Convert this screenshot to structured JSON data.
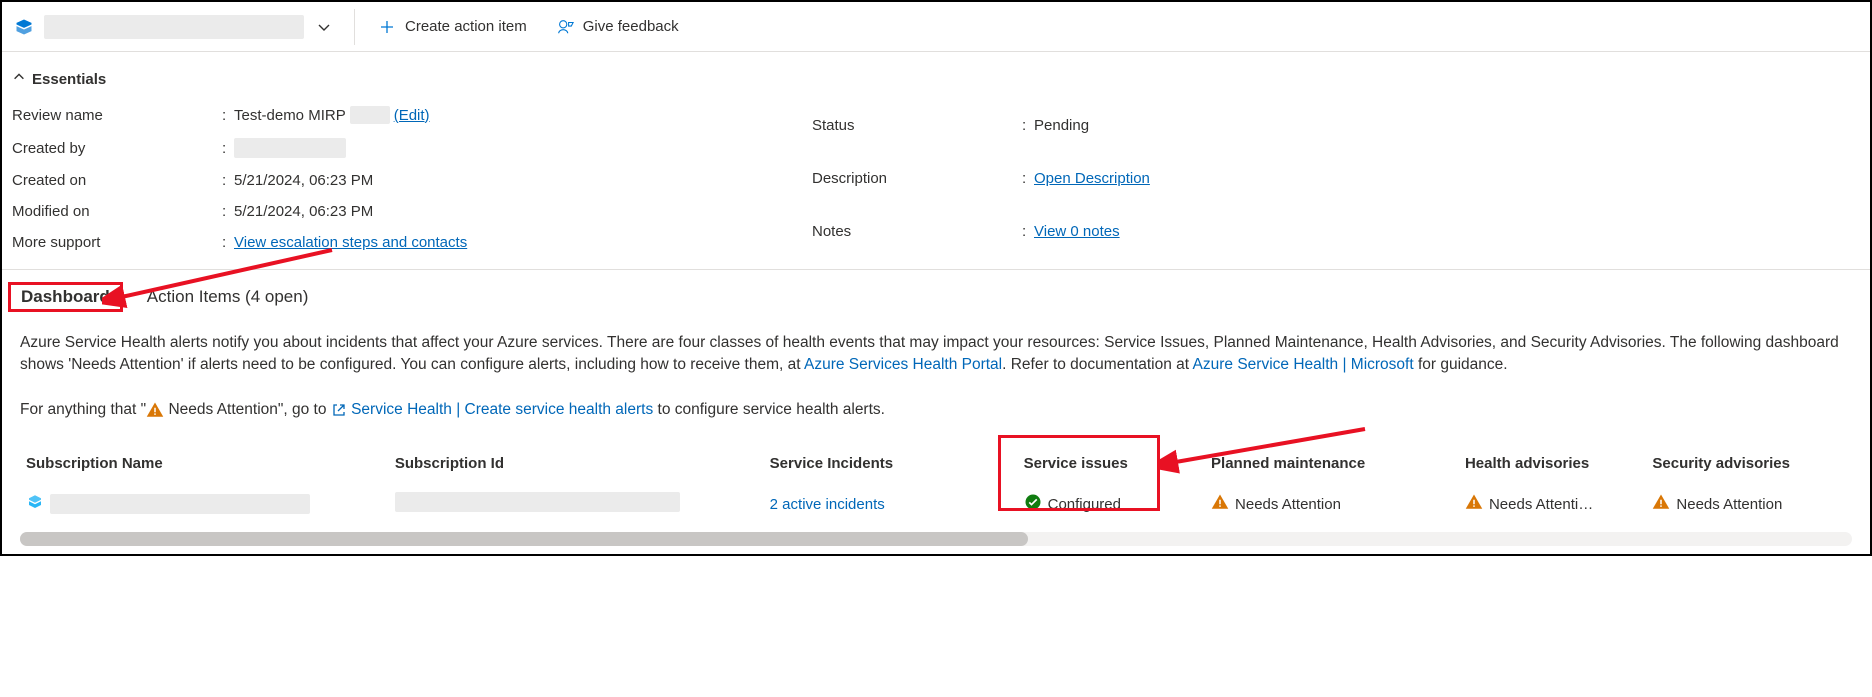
{
  "toolbar": {
    "create_label": "Create action item",
    "feedback_label": "Give feedback"
  },
  "essentials": {
    "section_title": "Essentials",
    "left": {
      "review_name_label": "Review name",
      "review_name_value": "Test-demo MIRP",
      "edit_label": "(Edit)",
      "created_by_label": "Created by",
      "created_on_label": "Created on",
      "created_on_value": "5/21/2024, 06:23 PM",
      "modified_on_label": "Modified on",
      "modified_on_value": "5/21/2024, 06:23 PM",
      "more_support_label": "More support",
      "more_support_link": "View escalation steps and contacts"
    },
    "right": {
      "status_label": "Status",
      "status_value": "Pending",
      "description_label": "Description",
      "description_link": "Open Description",
      "notes_label": "Notes",
      "notes_link": "View 0 notes"
    }
  },
  "tabs": {
    "dashboard": "Dashboard",
    "action_items": "Action Items (4 open)"
  },
  "body": {
    "p1_a": "Azure Service Health alerts notify you about incidents that affect your Azure services. There are four classes of health events that may impact your resources: Service Issues, Planned Maintenance, Health Advisories, and Security Advisories. The following dashboard shows 'Needs Attention' if alerts need to be configured. You can configure alerts, including how to receive them, at ",
    "p1_link1": "Azure Services Health Portal",
    "p1_b": ". Refer to documentation at ",
    "p1_link2": "Azure Service Health | Microsoft",
    "p1_c": " for guidance.",
    "p2_a": "For anything that \"",
    "p2_needs": " Needs Attention\", go to ",
    "p2_link": "Service Health | Create service health alerts",
    "p2_b": " to configure service health alerts."
  },
  "table": {
    "headers": {
      "sub_name": "Subscription Name",
      "sub_id": "Subscription Id",
      "service_incidents": "Service Incidents",
      "service_issues": "Service issues",
      "planned_maint": "Planned maintenance",
      "health_adv": "Health advisories",
      "security_adv": "Security advisories"
    },
    "row": {
      "incidents_link": "2 active incidents",
      "configured": "Configured",
      "needs_attention": "Needs Attention",
      "needs_attention_trunc": "Needs Attenti…"
    }
  }
}
